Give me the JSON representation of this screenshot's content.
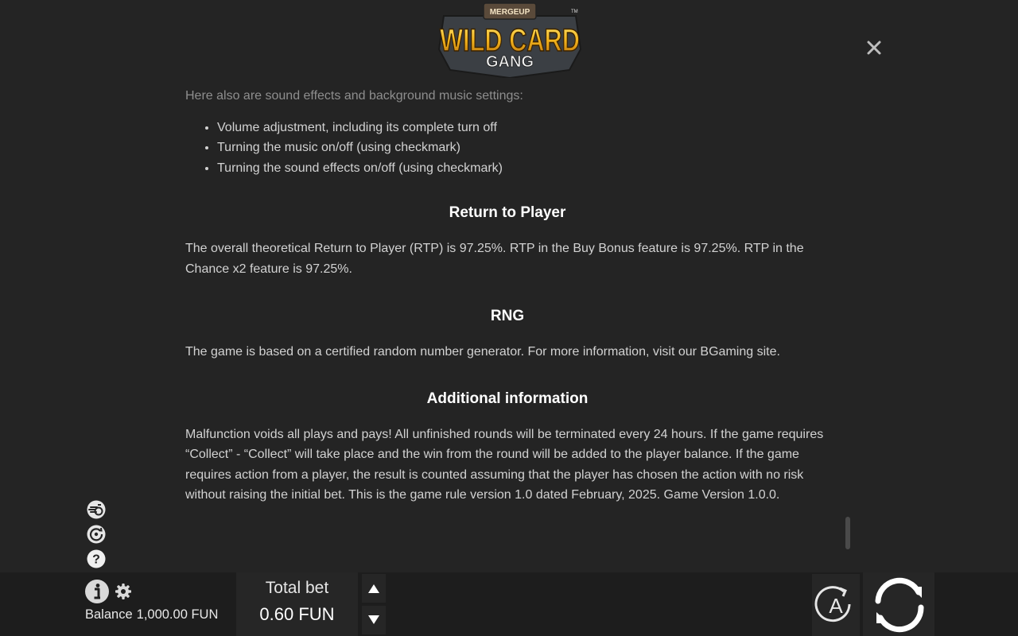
{
  "header": {
    "logo": {
      "small_text": "MERGEUP",
      "main_text": "WILD CARD",
      "sub_text": "GANG",
      "tm": "TM"
    },
    "close_icon": "close-icon"
  },
  "rules": {
    "intro": "Here also are sound effects and background music settings:",
    "sound_items": [
      "Volume adjustment, including its complete turn off",
      "Turning the music on/off (using checkmark)",
      "Turning the sound effects on/off (using checkmark)"
    ],
    "sections": [
      {
        "title": "Return to Player",
        "body": "The overall theoretical Return to Player (RTP) is 97.25%. RTP in the Buy Bonus feature is 97.25%. RTP in the Chance x2 feature is 97.25%."
      },
      {
        "title": "RNG",
        "body": "The game is based on a certified random number generator. For more information, visit our BGaming site."
      },
      {
        "title": "Additional information",
        "body": "Malfunction voids all plays and pays! All unfinished rounds will be terminated every 24 hours. If the game requires “Collect” - “Collect” will take place and the win from the round will be added to the player balance. If the game requires action from a player, the result is counted assuming that the player has chosen the action with no risk without raising the initial bet. This is the game rule version 1.0 dated February, 2025. Game Version 1.0.0."
      }
    ]
  },
  "side_icons": [
    "turbo-icon",
    "history-icon",
    "help-icon"
  ],
  "footer": {
    "info_icon": "info-icon",
    "settings_icon": "gear-icon",
    "balance_label": "Balance",
    "balance_value": "1,000.00 FUN",
    "total_bet_label": "Total bet",
    "total_bet_value": "0.60 FUN",
    "auto_label": "A",
    "colors": {
      "background": "#242424",
      "bar": "#1d1d1d",
      "accent_gold": "#f2b31c"
    }
  }
}
